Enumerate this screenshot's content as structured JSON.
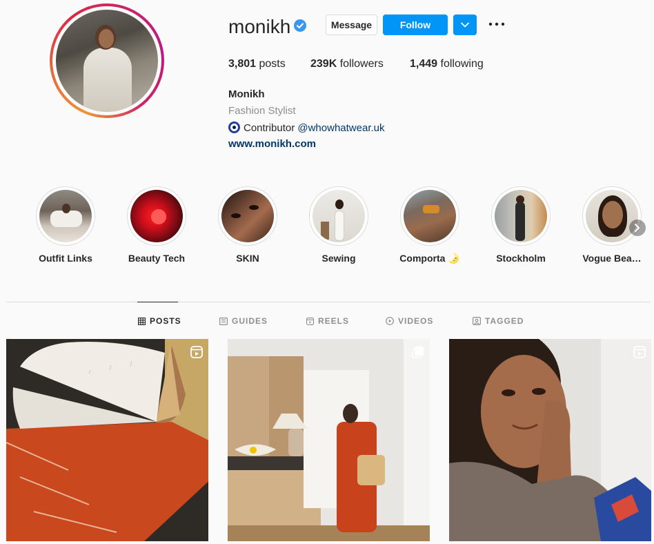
{
  "profile": {
    "username": "monikh",
    "message_label": "Message",
    "follow_label": "Follow",
    "stats": {
      "posts_count": "3,801",
      "posts_label": "posts",
      "followers_count": "239K",
      "followers_label": "followers",
      "following_count": "1,449",
      "following_label": "following"
    },
    "full_name": "Monikh",
    "category": "Fashion Stylist",
    "bio_text": "Contributor",
    "bio_mention": "@whowhatwear.uk",
    "website": "www.monikh.com"
  },
  "highlights": [
    {
      "label": "Outfit Links"
    },
    {
      "label": "Beauty Tech"
    },
    {
      "label": "SKIN"
    },
    {
      "label": "Sewing"
    },
    {
      "label": "Comporta 🌛"
    },
    {
      "label": "Stockholm"
    },
    {
      "label": "Vogue Bea…"
    }
  ],
  "tabs": [
    {
      "label": "POSTS",
      "icon": "grid-icon",
      "active": true
    },
    {
      "label": "GUIDES",
      "icon": "guides-icon",
      "active": false
    },
    {
      "label": "REELS",
      "icon": "reels-icon",
      "active": false
    },
    {
      "label": "VIDEOS",
      "icon": "videos-icon",
      "active": false
    },
    {
      "label": "TAGGED",
      "icon": "tagged-icon",
      "active": false
    }
  ],
  "posts": [
    {
      "type": "reel",
      "badge_icon": "reels-badge-icon"
    },
    {
      "type": "carousel",
      "badge_icon": "carousel-badge-icon"
    },
    {
      "type": "reel",
      "badge_icon": "reels-badge-icon"
    }
  ],
  "colors": {
    "accent": "#0095f6",
    "link": "#00376b",
    "verified": "#3897f0",
    "muted": "#8e8e8e",
    "border": "#dbdbdb"
  }
}
